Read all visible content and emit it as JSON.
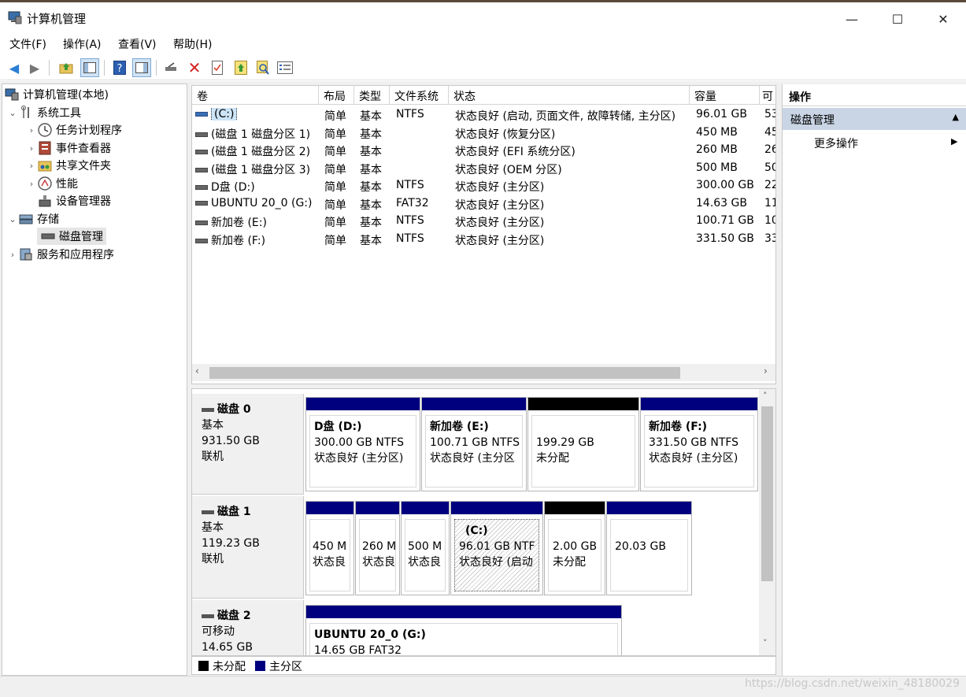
{
  "window": {
    "title": "计算机管理",
    "controls": {
      "minimize": "—",
      "maximize": "☐",
      "close": "✕"
    }
  },
  "menu": [
    "文件(F)",
    "操作(A)",
    "查看(V)",
    "帮助(H)"
  ],
  "toolbar_icons": [
    "back-arrow-icon",
    "forward-arrow-icon",
    "up-folder-icon",
    "show-tree-icon",
    "help-icon",
    "show-action-pane-icon",
    "connect-icon",
    "delete-icon",
    "properties-icon",
    "export-icon",
    "search-icon",
    "list-icon"
  ],
  "tree": {
    "root": "计算机管理(本地)",
    "system_tools": "系统工具",
    "task_scheduler": "任务计划程序",
    "event_viewer": "事件查看器",
    "shared_folders": "共享文件夹",
    "performance": "性能",
    "device_manager": "设备管理器",
    "storage": "存储",
    "disk_management": "磁盘管理",
    "services": "服务和应用程序"
  },
  "volumes": {
    "columns": [
      "卷",
      "布局",
      "类型",
      "文件系统",
      "状态",
      "容量",
      "可"
    ],
    "rows": [
      {
        "name": "(C:)",
        "layout": "简单",
        "type": "基本",
        "fs": "NTFS",
        "status": "状态良好 (启动, 页面文件, 故障转储, 主分区)",
        "capacity": "96.01 GB",
        "free": "53"
      },
      {
        "name": "(磁盘 1 磁盘分区 1)",
        "layout": "简单",
        "type": "基本",
        "fs": "",
        "status": "状态良好 (恢复分区)",
        "capacity": "450 MB",
        "free": "45"
      },
      {
        "name": "(磁盘 1 磁盘分区 2)",
        "layout": "简单",
        "type": "基本",
        "fs": "",
        "status": "状态良好 (EFI 系统分区)",
        "capacity": "260 MB",
        "free": "26"
      },
      {
        "name": "(磁盘 1 磁盘分区 3)",
        "layout": "简单",
        "type": "基本",
        "fs": "",
        "status": "状态良好 (OEM 分区)",
        "capacity": "500 MB",
        "free": "50"
      },
      {
        "name": "D盘 (D:)",
        "layout": "简单",
        "type": "基本",
        "fs": "NTFS",
        "status": "状态良好 (主分区)",
        "capacity": "300.00 GB",
        "free": "22"
      },
      {
        "name": "UBUNTU 20_0 (G:)",
        "layout": "简单",
        "type": "基本",
        "fs": "FAT32",
        "status": "状态良好 (主分区)",
        "capacity": "14.63 GB",
        "free": "11"
      },
      {
        "name": "新加卷 (E:)",
        "layout": "简单",
        "type": "基本",
        "fs": "NTFS",
        "status": "状态良好 (主分区)",
        "capacity": "100.71 GB",
        "free": "10"
      },
      {
        "name": "新加卷 (F:)",
        "layout": "简单",
        "type": "基本",
        "fs": "NTFS",
        "status": "状态良好 (主分区)",
        "capacity": "331.50 GB",
        "free": "33"
      }
    ]
  },
  "disks": {
    "disk0": {
      "name": "磁盘 0",
      "type": "基本",
      "size": "931.50 GB",
      "state": "联机",
      "parts": [
        {
          "title": "D盘  (D:)",
          "line1": "300.00 GB NTFS",
          "line2": "状态良好 (主分区)"
        },
        {
          "title": "新加卷  (E:)",
          "line1": "100.71 GB NTFS",
          "line2": "状态良好 (主分区"
        },
        {
          "title": "",
          "line1": "199.29 GB",
          "line2": "未分配"
        },
        {
          "title": "新加卷  (F:)",
          "line1": "331.50 GB NTFS",
          "line2": "状态良好 (主分区)"
        }
      ]
    },
    "disk1": {
      "name": "磁盘 1",
      "type": "基本",
      "size": "119.23 GB",
      "state": "联机",
      "parts": [
        {
          "line1": "450 M",
          "line2": "状态良"
        },
        {
          "line1": "260 M",
          "line2": "状态良"
        },
        {
          "line1": "500 M",
          "line2": "状态良"
        },
        {
          "title": "(C:)",
          "line1": "96.01 GB NTF",
          "line2": "状态良好 (启动"
        },
        {
          "line1": "2.00 GB",
          "line2": "未分配"
        },
        {
          "line1": "20.03 GB",
          "line2": ""
        }
      ]
    },
    "disk2": {
      "name": "磁盘 2",
      "type": "可移动",
      "size": "14.65 GB",
      "parts": [
        {
          "title": "UBUNTU 20_0  (G:)",
          "line1": "14.65 GB FAT32"
        }
      ]
    }
  },
  "legend": {
    "unallocated": "未分配",
    "primary": "主分区"
  },
  "actions": {
    "header": "操作",
    "section": "磁盘管理",
    "more": "更多操作"
  },
  "watermark": "https://blog.csdn.net/weixin_48180029",
  "colors": {
    "primary_partition": "#00007f",
    "unallocated": "#000000",
    "selection": "#cce4f7",
    "action_header": "#c9d5e4"
  }
}
